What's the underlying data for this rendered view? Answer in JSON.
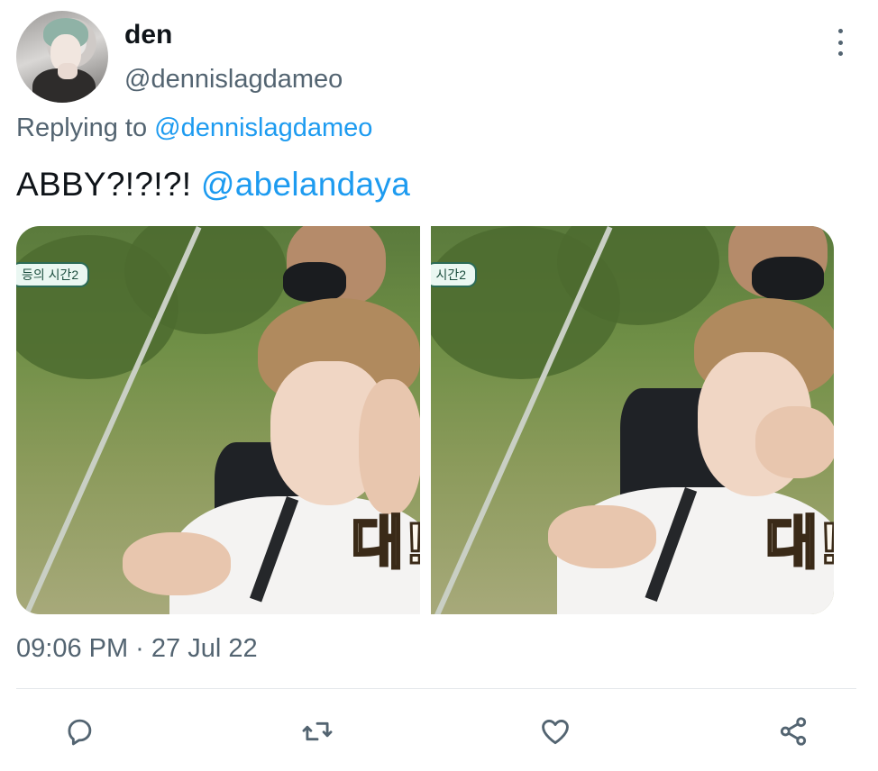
{
  "author": {
    "display_name": "den",
    "handle": "@dennislagdameo"
  },
  "reply": {
    "prefix": "Replying to",
    "target": "@dennislagdameo"
  },
  "tweet": {
    "text": "ABBY?!?!?!",
    "mention": "@abelandaya"
  },
  "media": {
    "left": {
      "badge": "등의 시간2",
      "caption": "대!"
    },
    "right": {
      "badge": "시간2",
      "caption": "대!"
    }
  },
  "meta": {
    "timestamp": "09:06 PM · 27 Jul 22"
  },
  "actions": {
    "reply_icon": "comment-icon",
    "retweet_icon": "retweet-icon",
    "like_icon": "heart-icon",
    "share_icon": "share-icon"
  },
  "colors": {
    "link": "#1d9bf0",
    "secondary_text": "#536471",
    "primary_text": "#0f1419",
    "divider": "#e4e8eb"
  }
}
